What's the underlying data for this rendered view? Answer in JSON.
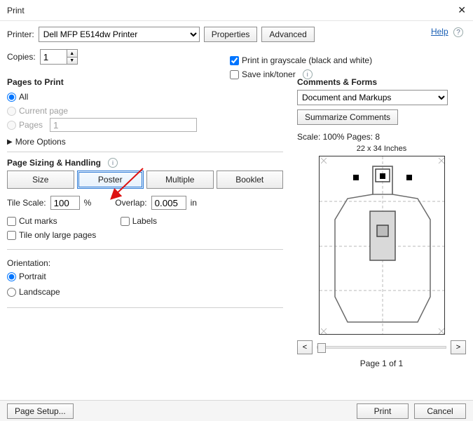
{
  "window": {
    "title": "Print"
  },
  "help": {
    "label": "Help"
  },
  "printer": {
    "label": "Printer:",
    "selected": "Dell MFP E514dw Printer",
    "properties_btn": "Properties",
    "advanced_btn": "Advanced"
  },
  "copies": {
    "label": "Copies:",
    "value": "1"
  },
  "options": {
    "grayscale": {
      "label": "Print in grayscale (black and white)",
      "checked": true
    },
    "saveink": {
      "label": "Save ink/toner",
      "checked": false
    }
  },
  "pages_to_print": {
    "title": "Pages to Print",
    "all": "All",
    "current": "Current page",
    "pages": "Pages",
    "pages_value": "1",
    "more": "More Options"
  },
  "sizing": {
    "title": "Page Sizing & Handling",
    "size": "Size",
    "poster": "Poster",
    "multiple": "Multiple",
    "booklet": "Booklet",
    "tile_scale_label": "Tile Scale:",
    "tile_scale": "100",
    "tile_scale_unit": "%",
    "overlap_label": "Overlap:",
    "overlap": "0.005",
    "overlap_unit": "in",
    "cut_marks": "Cut marks",
    "labels": "Labels",
    "tile_only": "Tile only large pages"
  },
  "orientation": {
    "title": "Orientation:",
    "portrait": "Portrait",
    "landscape": "Landscape"
  },
  "comments": {
    "title": "Comments & Forms",
    "selected": "Document and Markups",
    "summarize": "Summarize Comments"
  },
  "preview": {
    "scale_text": "Scale: 100% Pages: 8",
    "dimensions": "22 x 34 Inches",
    "prev": "<",
    "next": ">",
    "page_of": "Page 1 of 1"
  },
  "bottom": {
    "page_setup": "Page Setup...",
    "print": "Print",
    "cancel": "Cancel"
  }
}
